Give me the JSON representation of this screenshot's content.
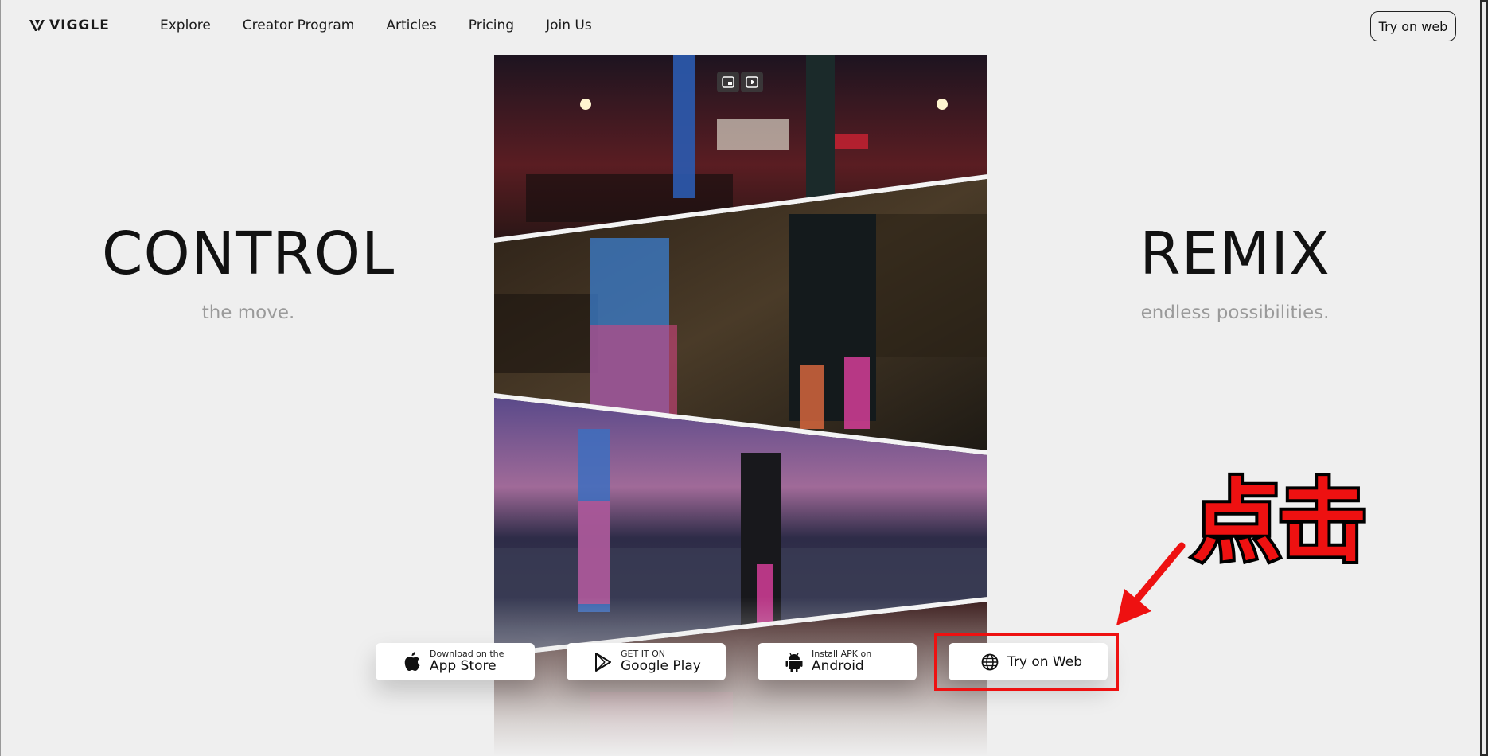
{
  "header": {
    "logo_text": "VIGGLE",
    "nav": [
      "Explore",
      "Creator Program",
      "Articles",
      "Pricing",
      "Join Us"
    ],
    "try_web_label": "Try on web"
  },
  "hero": {
    "left_title": "CONTROL",
    "left_sub": "the move.",
    "right_title": "REMIX",
    "right_sub": "endless possibilities."
  },
  "downloads": {
    "app_store": {
      "small": "Download on the",
      "big": "App Store",
      "icon": "apple-icon"
    },
    "google_play": {
      "small": "GET IT ON",
      "big": "Google Play",
      "icon": "google-play-icon"
    },
    "android": {
      "small": "Install APK on",
      "big": "Android",
      "icon": "android-icon"
    },
    "web": {
      "label": "Try on Web",
      "icon": "globe-icon"
    }
  },
  "annotation": {
    "text": "点击",
    "color": "#ee1111"
  },
  "colors": {
    "background": "#efefef",
    "subtitle": "#9a9a9a",
    "annotation_red": "#ee1111"
  }
}
